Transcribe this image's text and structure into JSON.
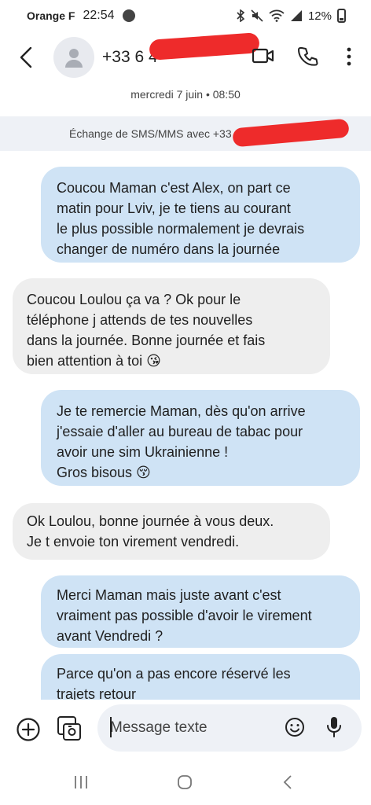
{
  "status_bar": {
    "carrier": "Orange F",
    "time": "22:54",
    "notification_badge": "Ooo",
    "battery": "12%"
  },
  "header": {
    "contact_visible": "+33 6 4",
    "icons": [
      "back-arrow-icon",
      "person-avatar-icon",
      "video-call-icon",
      "phone-icon",
      "more-vert-icon"
    ]
  },
  "conversation": {
    "date": "mercredi 7 juin • 08:50",
    "exchange_label": "Échange de SMS/MMS avec +33",
    "messages": [
      {
        "direction": "sent",
        "text": "Coucou Maman c'est Alex, on part ce\nmatin pour Lviv, je te tiens au courant\nle plus possible normalement je devrais\nchanger de numéro dans la journée"
      },
      {
        "direction": "received",
        "text": "Coucou Loulou ça va ? Ok pour le\ntéléphone j attends de tes nouvelles\ndans la journée. Bonne journée et fais\nbien attention à toi 😘"
      },
      {
        "direction": "sent",
        "text": "Je te remercie Maman, dès qu'on arrive\nj'essaie d'aller au bureau de tabac pour\navoir une sim Ukrainienne !\nGros bisous 😚"
      },
      {
        "direction": "received",
        "text": "Ok Loulou, bonne journée à vous deux.\nJe t envoie ton virement vendredi."
      },
      {
        "direction": "sent",
        "text": "Merci Maman mais juste avant c'est\nvraiment pas possible d'avoir le virement\navant Vendredi ?"
      },
      {
        "direction": "sent",
        "text": "Parce qu'on a pas encore réservé les\ntrajets retour"
      }
    ]
  },
  "composer": {
    "placeholder": "Message texte"
  },
  "colors": {
    "sent_bubble": "#cfe3f5",
    "received_bubble": "#eeeeee",
    "redaction": "#ee2b2b"
  }
}
